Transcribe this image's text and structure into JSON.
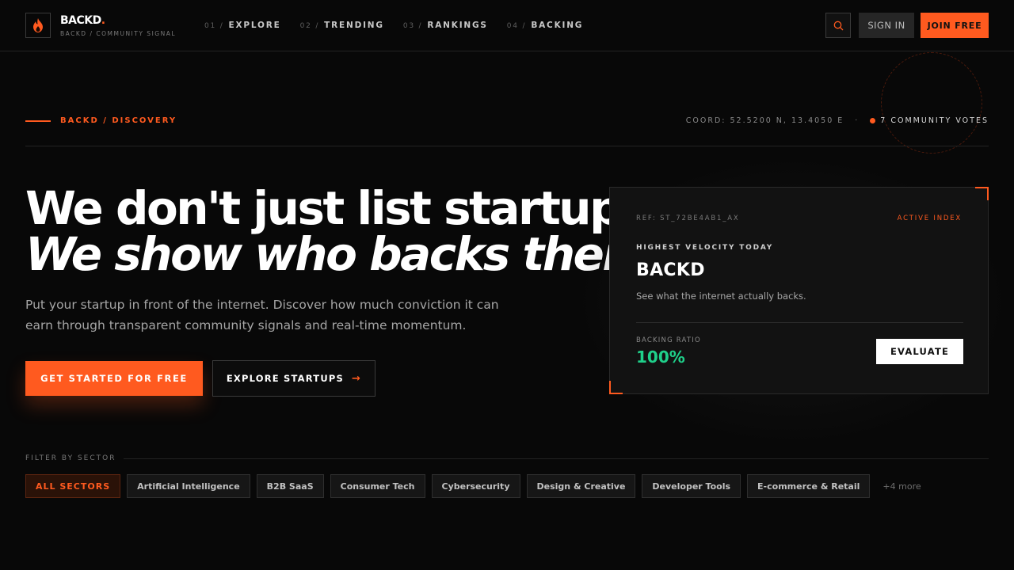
{
  "brand": {
    "name": "BACKD",
    "dot": ".",
    "subtitle": "BACKD / COMMUNITY SIGNAL",
    "accent_color": "#ff5a1f"
  },
  "nav": {
    "links": [
      {
        "num": "01 /",
        "label": "EXPLORE"
      },
      {
        "num": "02 /",
        "label": "TRENDING"
      },
      {
        "num": "03 /",
        "label": "RANKINGS"
      },
      {
        "num": "04 /",
        "label": "BACKING"
      }
    ],
    "search_icon": "search-icon",
    "signin_label": "SIGN IN",
    "join_label": "JOIN FREE"
  },
  "meta": {
    "section_label": "BACKD / DISCOVERY",
    "coord": "COORD: 52.5200 N, 13.4050 E",
    "separator": "·",
    "votes": "7 COMMUNITY VOTES"
  },
  "hero": {
    "line1": "We don't just list startups.",
    "line2": "We show who backs them.",
    "description": "Put your startup in front of the internet. Discover how much conviction it can earn through transparent community signals and real-time momentum.",
    "cta_primary": "GET STARTED FOR FREE",
    "cta_secondary": "EXPLORE STARTUPS",
    "cta_secondary_arrow": "→"
  },
  "card": {
    "ref": "REF: ST_72BE4AB1_AX",
    "status": "ACTIVE INDEX",
    "kicker": "HIGHEST VELOCITY TODAY",
    "title": "BACKD",
    "description": "See what the internet actually backs.",
    "ratio_label": "BACKING RATIO",
    "ratio_value": "100%",
    "ratio_color": "#1fd08a",
    "evaluate_label": "EVALUATE"
  },
  "filter": {
    "label": "FILTER BY SECTOR",
    "chips": [
      "ALL SECTORS",
      "Artificial Intelligence",
      "B2B SaaS",
      "Consumer Tech",
      "Cybersecurity",
      "Design & Creative",
      "Developer Tools",
      "E-commerce & Retail"
    ],
    "more": "+4 more"
  }
}
